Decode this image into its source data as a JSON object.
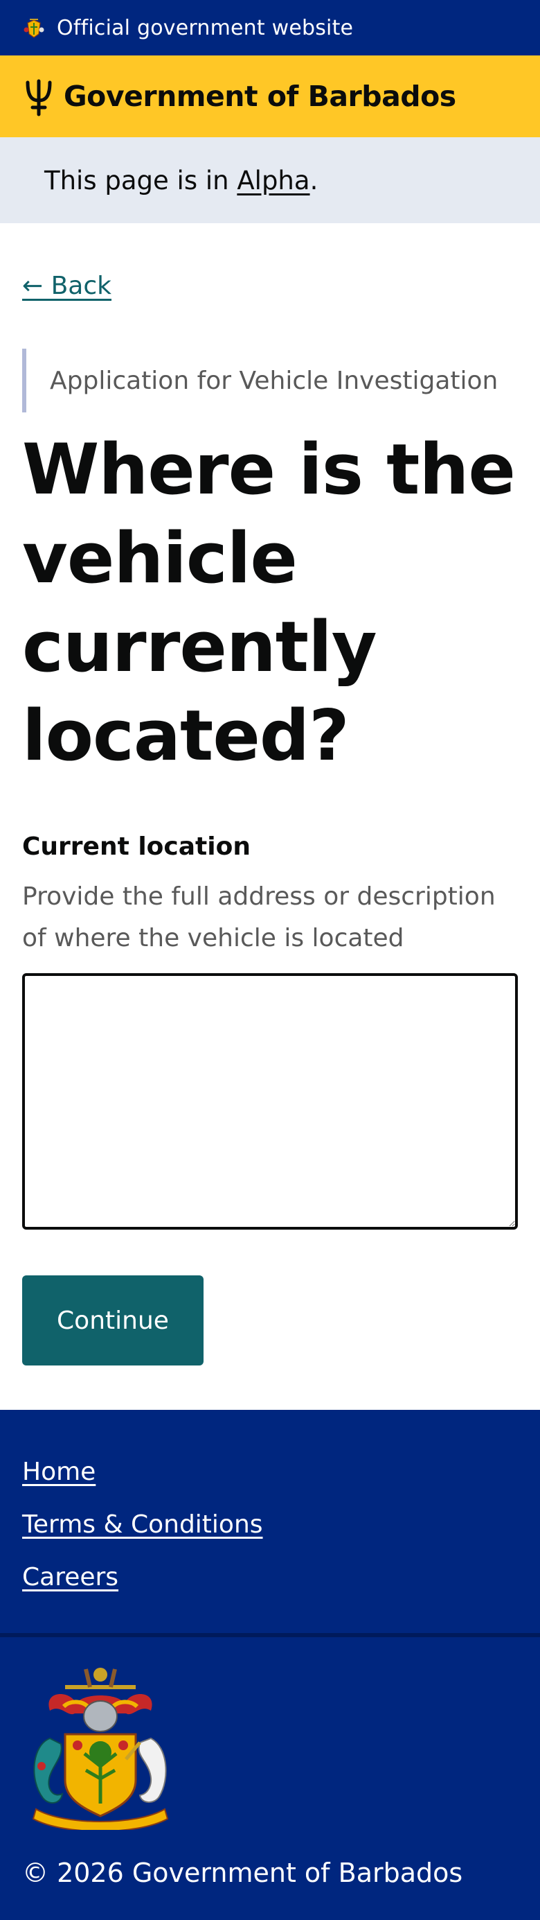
{
  "topbar": {
    "official_text": "Official government website",
    "crest_icon": "barbados-crest-icon"
  },
  "brand": {
    "name": "Government of Barbados",
    "trident_icon": "trident-icon"
  },
  "phase_banner": {
    "prefix": "This page is in ",
    "tag": "Alpha",
    "suffix": "."
  },
  "back_link": "← Back",
  "caption": "Application for Vehicle Investigation",
  "title": "Where is the vehicle currently located?",
  "field": {
    "label": "Current location",
    "hint": "Provide the full address or description of where the vehicle is located",
    "value": ""
  },
  "continue_label": "Continue",
  "footer": {
    "links": [
      "Home",
      "Terms & Conditions",
      "Careers"
    ],
    "coat_of_arms_motto": "PRIDE AND INDUSTRY",
    "copyright": "© 2026 Government of Barbados"
  },
  "colors": {
    "blue": "#00267f",
    "yellow": "#ffc726",
    "phase_bg": "#e5eaf2",
    "teal": "#10626a"
  }
}
